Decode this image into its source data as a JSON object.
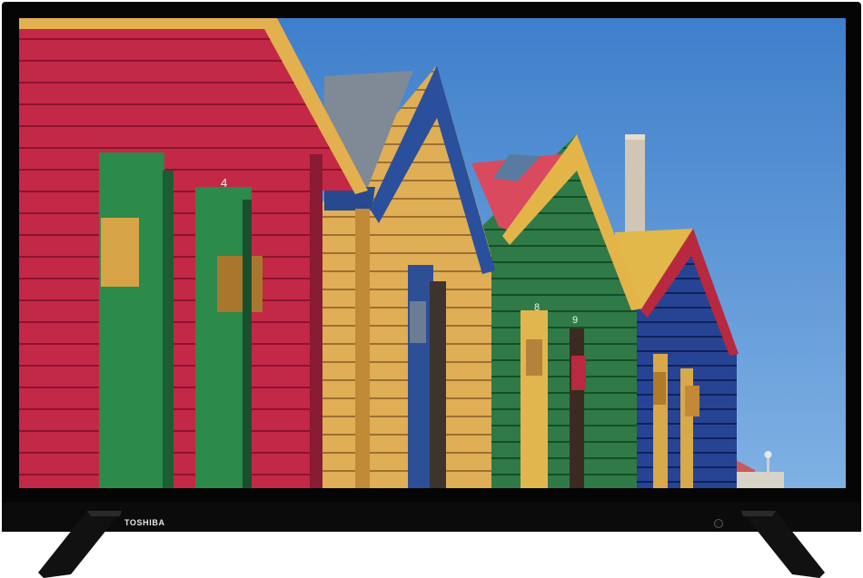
{
  "tv": {
    "brand": "TOSHIBA",
    "icons": {
      "brand": "toshiba-logo",
      "power": "power-led-icon",
      "stand_left": "stand-leg-left",
      "stand_right": "stand-leg-right"
    },
    "colors": {
      "frame": "#050505",
      "sky": "#4f8ccf",
      "hut_red": "#c42847",
      "hut_yellow": "#d9a64a",
      "hut_green": "#2f7a46",
      "hut_blue": "#233f8a"
    }
  },
  "screen_content": {
    "visible_markings": [
      "4",
      "8",
      "9"
    ]
  }
}
